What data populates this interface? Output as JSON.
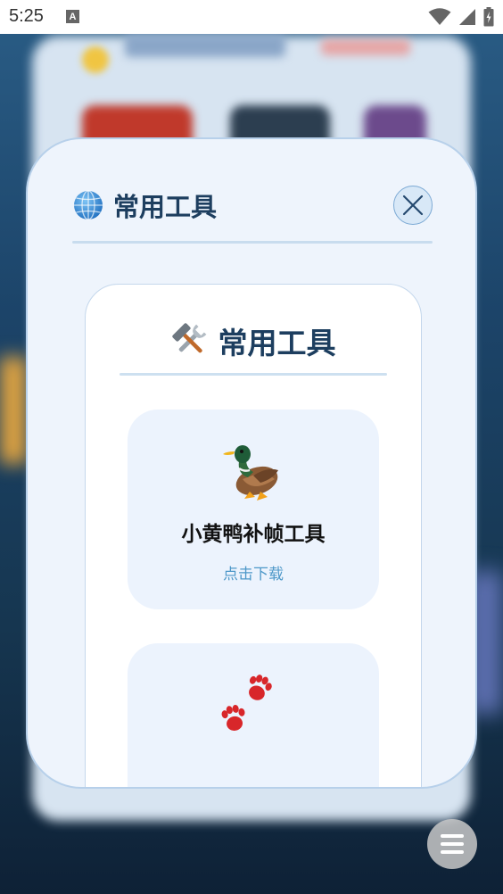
{
  "status_bar": {
    "time": "5:25",
    "notification_icon_letter": "A",
    "icons": [
      "wifi-icon",
      "signal-icon",
      "battery-icon"
    ]
  },
  "modal": {
    "title": "常用工具",
    "title_icon": "globe-icon",
    "close_icon": "close-icon"
  },
  "panel": {
    "title": "常用工具",
    "title_icon": "hammer-wrench-icon",
    "tools": [
      {
        "icon": "duck-icon",
        "name": "小黄鸭补帧工具",
        "action": "点击下载"
      },
      {
        "icon": "paw-prints-icon"
      }
    ]
  },
  "floating_menu": {
    "icon": "menu-icon"
  },
  "colors": {
    "modal_bg": "#eef4fc",
    "title": "#1d3e5f",
    "link": "#4e98c9",
    "card_bg": "#ecf3fd"
  }
}
